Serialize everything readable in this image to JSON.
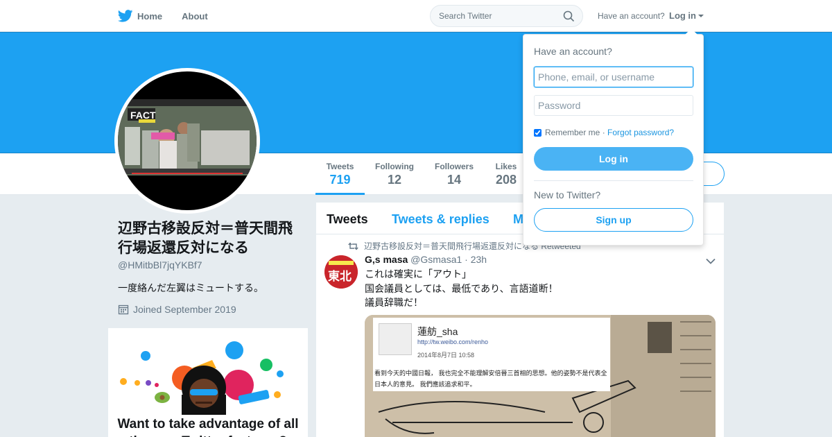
{
  "nav": {
    "home_label": "Home",
    "about_label": "About",
    "search_placeholder": "Search Twitter",
    "have_account": "Have an account?",
    "login_label": "Log in"
  },
  "profile": {
    "name": "辺野古移設反対＝普天間飛行場返還反対になる",
    "handle": "@HMitbBl7jqYKBf7",
    "bio": "一度絡んだ左翼はミュートする。",
    "joined": "Joined September 2019",
    "avatar_text": "FACT"
  },
  "stats": [
    {
      "label": "Tweets",
      "value": "719"
    },
    {
      "label": "Following",
      "value": "12"
    },
    {
      "label": "Followers",
      "value": "14"
    },
    {
      "label": "Likes",
      "value": "208"
    }
  ],
  "promo": {
    "text": "Want to take advantage of all the new Twitter features?"
  },
  "timeline": {
    "tabs": [
      "Tweets",
      "Tweets & replies",
      "Media"
    ],
    "retweet_context": "辺野古移設反対＝普天間飛行場返還反対になる Retweeted",
    "tweet": {
      "author_name": "G,s masa",
      "author_handle": "@Gsmasa1",
      "time": "23h",
      "lines": [
        "これは確実に「アウト」",
        "国会議員としては、最低であり、言語道断！",
        "議員辞職だ！"
      ],
      "avatar_text": "東北",
      "media": {
        "weibo_name": "蓮舫_sha",
        "weibo_url": "http://tw.weibo.com/renho",
        "weibo_date": "2014年8月7日 10:58",
        "weibo_body": "看到今天的中國日報， 我也完全不能理解安倍晉三首相的思想。他的姿勢不是代表全日本人的意見。 我們應該追求和平。"
      }
    }
  },
  "login_dropdown": {
    "title": "Have an account?",
    "username_placeholder": "Phone, email, or username",
    "password_placeholder": "Password",
    "remember_label": "Remember me",
    "separator": "·",
    "forgot_label": "Forgot password?",
    "login_button": "Log in",
    "new_label": "New to Twitter?",
    "signup_button": "Sign up"
  },
  "colors": {
    "brand": "#1da1f2",
    "background": "#e6ecf0"
  }
}
